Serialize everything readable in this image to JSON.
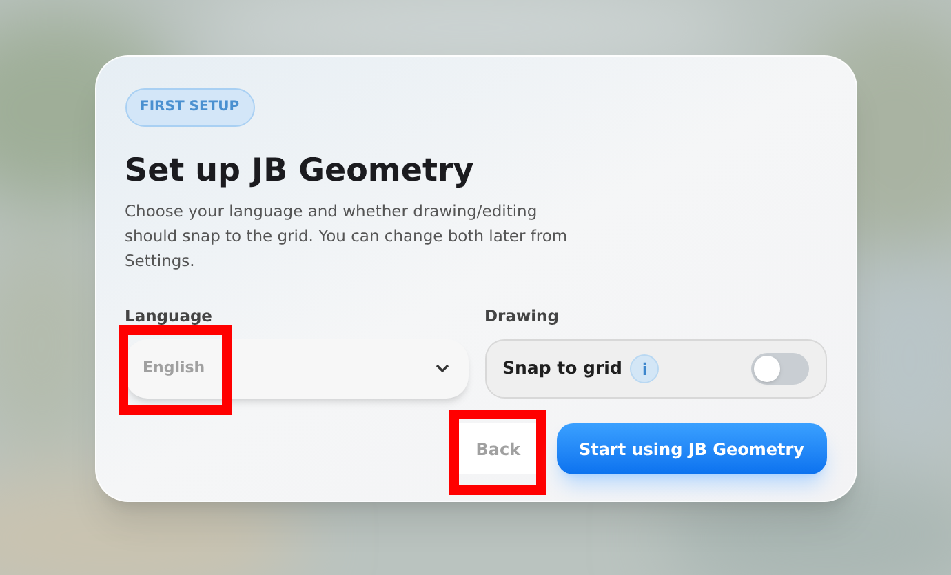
{
  "badge": "FIRST SETUP",
  "title": "Set up JB Geometry",
  "description": "Choose your language and whether drawing/editing should snap to the grid. You can change both later from Settings.",
  "language": {
    "label": "Language",
    "value": "English",
    "highlighted": true
  },
  "drawing": {
    "label": "Drawing",
    "option": "Snap to grid",
    "info": "i",
    "on": false
  },
  "buttons": [
    {
      "kind": "secondary",
      "label": "Back",
      "highlighted": true
    },
    {
      "kind": "primary",
      "label": "Start using JB Geometry",
      "highlighted": false
    }
  ]
}
